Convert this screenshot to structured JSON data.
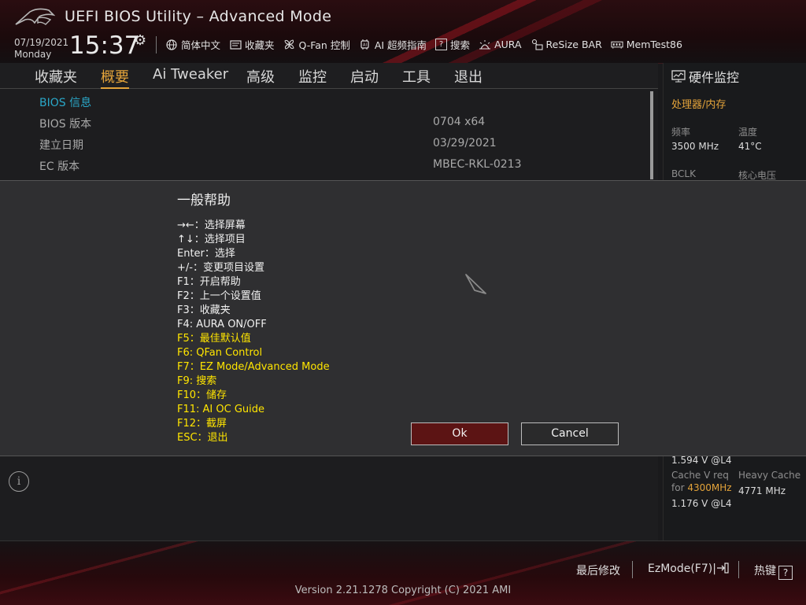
{
  "header": {
    "title": "UEFI BIOS Utility – Advanced Mode",
    "date": "07/19/2021",
    "weekday": "Monday",
    "time": "15:37",
    "toolbar": [
      {
        "label": "简体中文",
        "icon": "globe-icon"
      },
      {
        "label": "收藏夹",
        "icon": "favorites-icon"
      },
      {
        "label": "Q-Fan 控制",
        "icon": "fan-icon"
      },
      {
        "label": "AI 超频指南",
        "icon": "ai-chip-icon"
      },
      {
        "label": "搜索",
        "icon": "help-search-icon"
      },
      {
        "label": "AURA",
        "icon": "aura-light-icon"
      },
      {
        "label": "ReSize BAR",
        "icon": "resize-bar-icon"
      },
      {
        "label": "MemTest86",
        "icon": "memory-icon"
      }
    ]
  },
  "menu": {
    "items": [
      "收藏夹",
      "概要",
      "Ai Tweaker",
      "高级",
      "监控",
      "启动",
      "工具",
      "退出"
    ],
    "active": "概要"
  },
  "main": {
    "section_heading": "BIOS 信息",
    "rows": [
      {
        "label": "BIOS 版本",
        "value": "0704  x64"
      },
      {
        "label": "建立日期",
        "value": "03/29/2021"
      },
      {
        "label": "EC 版本",
        "value": "MBEC-RKL-0213"
      }
    ]
  },
  "hw_monitor": {
    "title": "硬件监控",
    "section": "处理器/内存",
    "freq_label": "频率",
    "freq_value": "3500 MHz",
    "temp_label": "温度",
    "temp_value": "41°C",
    "bclk_label": "BCLK",
    "vcore_label": "核心电压",
    "v1": "1.594 V @L4",
    "cache_v_label": "Cache V req",
    "cache_for": "for",
    "cache_for_freq": "4300MHz",
    "heavy_cache_label": "Heavy Cache",
    "heavy_cache_value": "4771 MHz",
    "v2": "1.176 V @L4"
  },
  "dialog": {
    "title": "一般帮助",
    "lines": [
      {
        "text": "→←：选择屏幕",
        "color": "white"
      },
      {
        "text": "↑↓：选择项目",
        "color": "white"
      },
      {
        "text": "Enter：选择",
        "color": "white"
      },
      {
        "text": "+/-：变更项目设置",
        "color": "white"
      },
      {
        "text": "F1：开启帮助",
        "color": "white"
      },
      {
        "text": "F2：上一个设置值",
        "color": "white"
      },
      {
        "text": "F3：收藏夹",
        "color": "white"
      },
      {
        "text": "F4: AURA ON/OFF",
        "color": "white"
      },
      {
        "text": "F5：最佳默认值",
        "color": "yellow"
      },
      {
        "text": "F6: QFan Control",
        "color": "yellow"
      },
      {
        "text": "F7：EZ Mode/Advanced Mode",
        "color": "yellow"
      },
      {
        "text": "F9: 搜索",
        "color": "yellow"
      },
      {
        "text": "F10：储存",
        "color": "yellow"
      },
      {
        "text": "F11: AI OC Guide",
        "color": "yellow"
      },
      {
        "text": "F12：截屏",
        "color": "yellow"
      },
      {
        "text": "ESC：退出",
        "color": "yellow"
      }
    ],
    "ok_label": "Ok",
    "cancel_label": "Cancel"
  },
  "footer": {
    "last_modified": "最后修改",
    "ez_mode": "EzMode(F7)|",
    "hotkeys": "热键",
    "hotkeys_key": "?",
    "version": "Version 2.21.1278 Copyright (C) 2021 AMI"
  },
  "colors": {
    "accent": "#e3a33a",
    "help_yellow": "#ffe500",
    "section_blue": "#2aa7c8",
    "ok_button": "#5c1414"
  }
}
